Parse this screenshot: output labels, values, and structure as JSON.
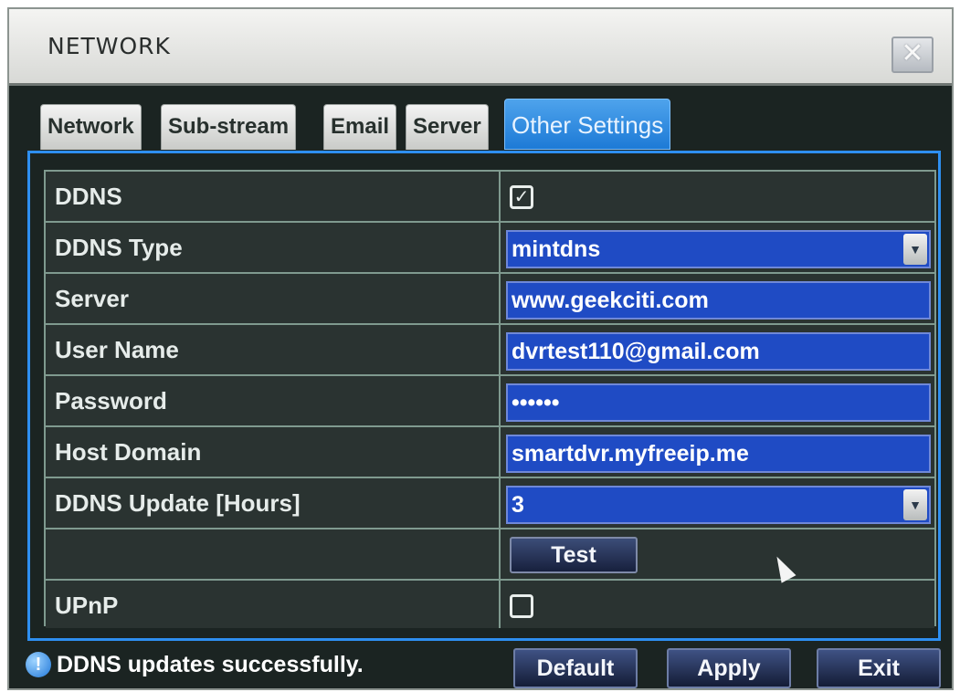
{
  "window": {
    "title": "NETWORK",
    "close_label": "✕"
  },
  "tabs": [
    {
      "label": "Network"
    },
    {
      "label": "Sub-stream"
    },
    {
      "label": "Email"
    },
    {
      "label": "Server"
    },
    {
      "label": "Other Settings",
      "active": true
    }
  ],
  "settings": {
    "ddns": {
      "label": "DDNS",
      "checked": true,
      "mark": "✓"
    },
    "ddns_type": {
      "label": "DDNS Type",
      "value": "mintdns"
    },
    "server": {
      "label": "Server",
      "value": "www.geekciti.com"
    },
    "user_name": {
      "label": "User Name",
      "value": "dvrtest110@gmail.com"
    },
    "password": {
      "label": "Password",
      "value": "••••••"
    },
    "host_domain": {
      "label": "Host Domain",
      "value": "smartdvr.myfreeip.me"
    },
    "ddns_update": {
      "label": "DDNS Update [Hours]",
      "value": "3"
    },
    "test_button": {
      "label": "Test"
    },
    "upnp": {
      "label": "UPnP",
      "checked": false,
      "mark": ""
    }
  },
  "status": {
    "icon": "!",
    "message": "DDNS updates successfully."
  },
  "footer": {
    "default_label": "Default",
    "apply_label": "Apply",
    "exit_label": "Exit"
  },
  "icons": {
    "dropdown": "▼"
  },
  "colors": {
    "accent": "#2e8ff0",
    "field_bg": "#1f4bc4",
    "panel_bg": "#1b2422"
  }
}
